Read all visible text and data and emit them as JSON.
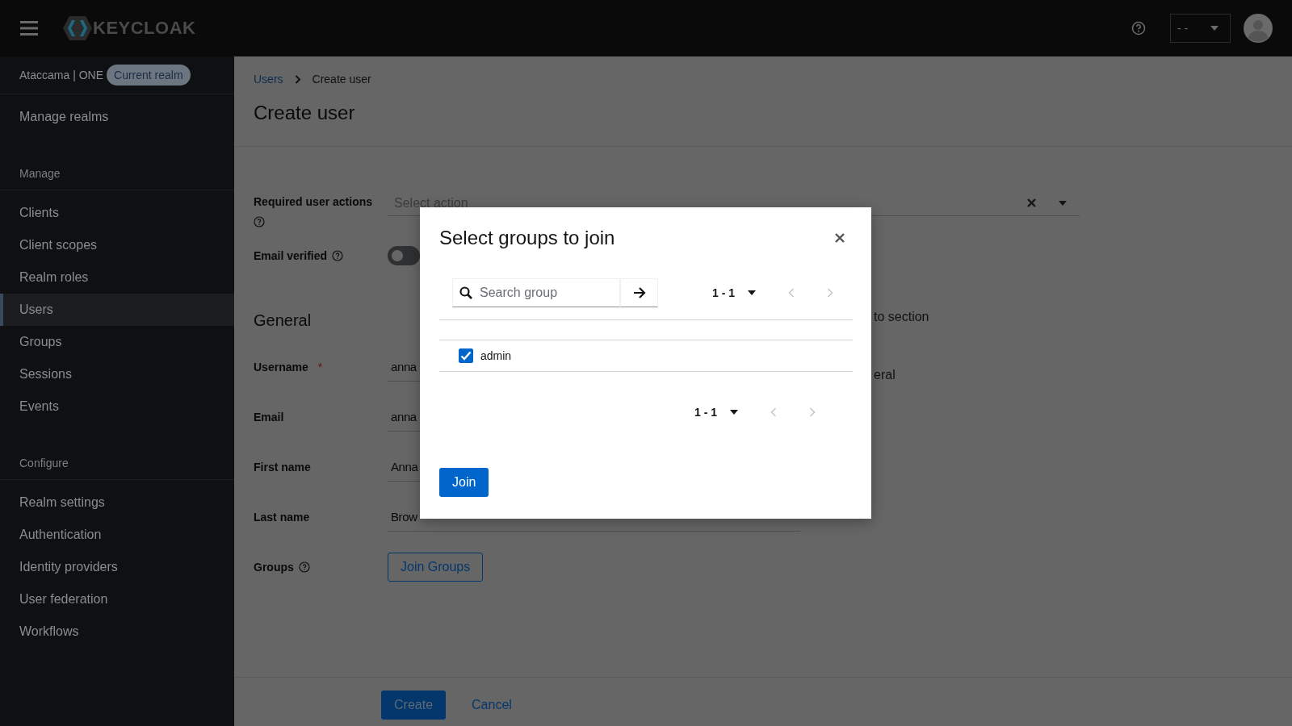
{
  "masthead": {
    "logo_text": "KEYCLOAK",
    "user_menu": "- -"
  },
  "sidebar": {
    "realm": "Ataccama | ONE",
    "realm_badge": "Current realm",
    "items": [
      {
        "kind": "link",
        "label": "Manage realms",
        "selected": false
      },
      {
        "kind": "heading",
        "label": "Manage"
      },
      {
        "kind": "link",
        "label": "Clients",
        "selected": false
      },
      {
        "kind": "link",
        "label": "Client scopes",
        "selected": false
      },
      {
        "kind": "link",
        "label": "Realm roles",
        "selected": false
      },
      {
        "kind": "link",
        "label": "Users",
        "selected": true
      },
      {
        "kind": "link",
        "label": "Groups",
        "selected": false
      },
      {
        "kind": "link",
        "label": "Sessions",
        "selected": false
      },
      {
        "kind": "link",
        "label": "Events",
        "selected": false
      },
      {
        "kind": "heading",
        "label": "Configure"
      },
      {
        "kind": "link",
        "label": "Realm settings",
        "selected": false
      },
      {
        "kind": "link",
        "label": "Authentication",
        "selected": false
      },
      {
        "kind": "link",
        "label": "Identity providers",
        "selected": false
      },
      {
        "kind": "link",
        "label": "User federation",
        "selected": false
      },
      {
        "kind": "link",
        "label": "Workflows",
        "selected": false
      }
    ]
  },
  "breadcrumb": [
    {
      "label": "Users",
      "kind": "link"
    },
    {
      "label": "Create user",
      "kind": "current"
    }
  ],
  "title": "Create user",
  "form": [
    {
      "kind": "select",
      "label": "Required user actions",
      "help": true,
      "placeholder": "Select action"
    },
    {
      "kind": "toggle",
      "label": "Email verified",
      "help": true,
      "on": false
    },
    {
      "kind": "heading",
      "label": "General"
    },
    {
      "kind": "text",
      "label": "Username",
      "required_mark": "*",
      "value": "anna"
    },
    {
      "kind": "text",
      "label": "Email",
      "value": "anna"
    },
    {
      "kind": "text",
      "label": "First name",
      "value": "Anna"
    },
    {
      "kind": "text",
      "label": "Last name",
      "value": "Brow"
    },
    {
      "kind": "button",
      "label": "Groups",
      "help": true,
      "button": "Join Groups"
    }
  ],
  "jump_links": [
    "to section",
    "eral"
  ],
  "footer": [
    {
      "kind": "primary",
      "label": "Create"
    },
    {
      "kind": "link",
      "label": "Cancel"
    }
  ],
  "modal": {
    "title": "Select groups to join",
    "search_placeholder": "Search group",
    "pagination_top": "1 - 1",
    "pagination_bottom": "1 - 1",
    "rows": [
      {
        "name": "admin",
        "checked": true
      }
    ],
    "button": "Join"
  }
}
